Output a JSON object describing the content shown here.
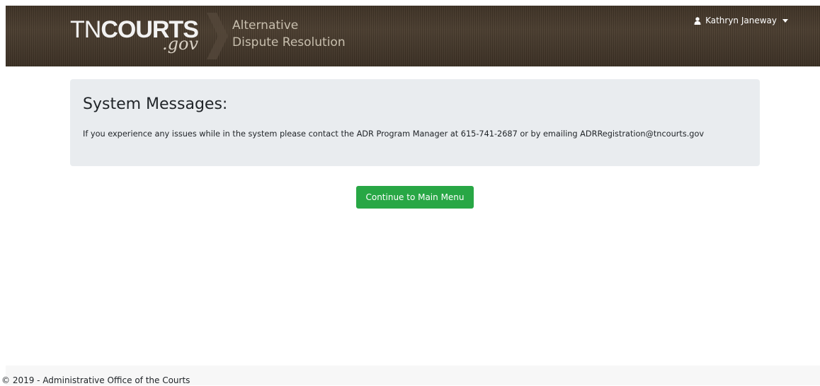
{
  "header": {
    "logo": {
      "main_prefix": "TN",
      "main_bold": "COURTS",
      "suffix": ".gov"
    },
    "brand_line1": "Alternative",
    "brand_line2": "Dispute Resolution",
    "user": {
      "name": "Kathryn Janeway",
      "icon": "user-icon"
    }
  },
  "messages": {
    "title": "System Messages:",
    "body": "If you experience any issues while in the system please contact the ADR Program Manager at 615-741-2687 or by emailing ADRRegistration@tncourts.gov"
  },
  "actions": {
    "continue_label": "Continue to Main Menu"
  },
  "footer": {
    "text": "© 2019 - Administrative Office of the Courts"
  },
  "colors": {
    "header_bg": "#3e3225",
    "brand_text": "#c8bfae",
    "panel_bg": "#e9ecef",
    "button_green": "#28a745"
  }
}
